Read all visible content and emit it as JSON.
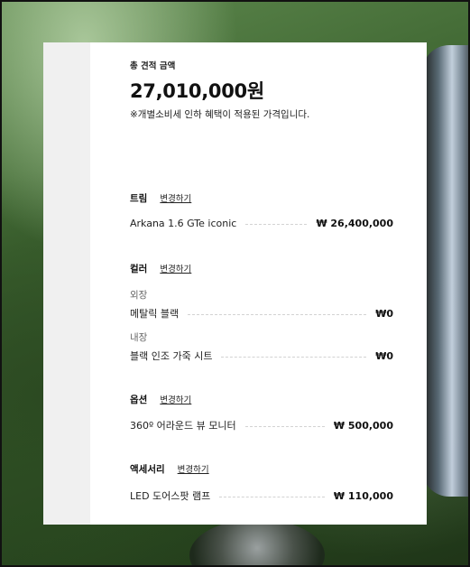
{
  "summary": {
    "total_label": "총 견적 금액",
    "total_price": "27,010,000원",
    "note": "※개별소비세 인하 혜택이 적용된 가격입니다."
  },
  "sections": {
    "trim": {
      "title": "트림",
      "change_label": "변경하기",
      "item": {
        "name": "Arkana 1.6 GTe iconic",
        "price": "₩ 26,400,000"
      }
    },
    "color": {
      "title": "컬러",
      "change_label": "변경하기",
      "exterior": {
        "label": "외장",
        "name": "메탈릭 블랙",
        "price": "₩0"
      },
      "interior": {
        "label": "내장",
        "name": "블랙 인조 가죽 시트",
        "price": "₩0"
      }
    },
    "option": {
      "title": "옵션",
      "change_label": "변경하기",
      "item": {
        "name": "360º 어라운드 뷰 모니터",
        "price": "₩ 500,000"
      }
    },
    "accessory": {
      "title": "액세서리",
      "change_label": "변경하기",
      "item": {
        "name": "LED 도어스팟 램프",
        "price": "₩ 110,000"
      }
    }
  }
}
